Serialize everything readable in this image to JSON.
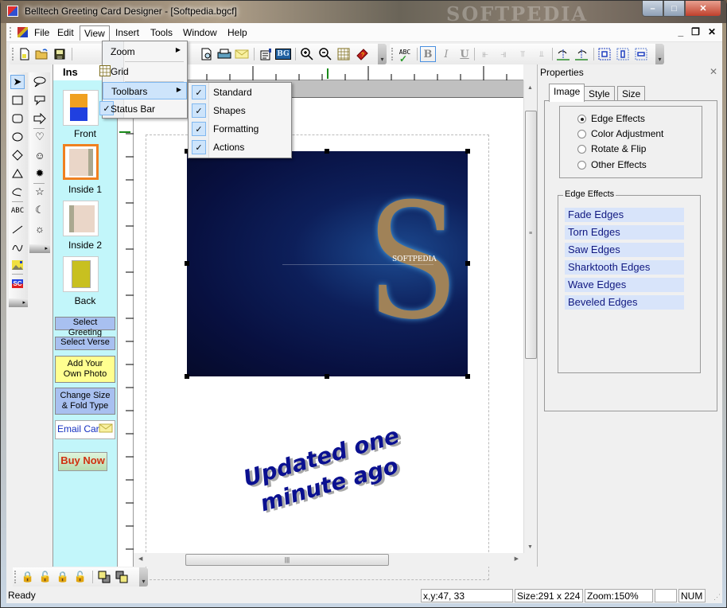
{
  "window": {
    "title": "Belltech Greeting Card Designer  - [Softpedia.bgcf]",
    "watermark": "SOFTPEDIA",
    "caption_minimize": "–",
    "caption_maximize": "□",
    "caption_close": "✕"
  },
  "menubar": {
    "items": [
      "File",
      "Edit",
      "View",
      "Insert",
      "Tools",
      "Window",
      "Help"
    ],
    "active": "View",
    "mdi_minimize": "_",
    "mdi_restore": "❐",
    "mdi_close": "✕"
  },
  "view_menu": {
    "items": [
      {
        "label": "Zoom",
        "has_submenu": true,
        "checked": false
      },
      {
        "label": "Grid",
        "has_submenu": false,
        "checked": false,
        "icon": "grid-icon"
      },
      {
        "label": "Toolbars",
        "has_submenu": true,
        "highlighted": true
      },
      {
        "label": "Status Bar",
        "checked": true
      }
    ]
  },
  "toolbars_submenu": {
    "items": [
      {
        "label": "Standard",
        "checked": true
      },
      {
        "label": "Shapes",
        "checked": true
      },
      {
        "label": "Formatting",
        "checked": true
      },
      {
        "label": "Actions",
        "checked": true
      }
    ]
  },
  "standard_toolbar": {
    "icons": [
      "new-file-icon",
      "open-folder-icon",
      "save-icon",
      "print-preview-icon",
      "print-icon",
      "email-icon",
      "properties-icon",
      "background-icon",
      "zoom-in-icon",
      "zoom-out-icon",
      "grid-icon",
      "help-book-icon"
    ],
    "bg_label": "BG"
  },
  "formatting_toolbar": {
    "spellcheck_label": "ABC",
    "bold": "B",
    "italic": "I",
    "underline": "U",
    "icons": [
      "spellcheck-icon",
      "bold-icon",
      "italic-icon",
      "underline-icon",
      "align-left-icon",
      "align-right-icon",
      "align-top-icon",
      "align-bottom-icon",
      "rotate-right-icon",
      "rotate-left-icon",
      "center-icon",
      "center-horizontal-icon",
      "center-vertical-icon"
    ]
  },
  "shapes_toolbar": {
    "column1": [
      "select-arrow",
      "rectangle",
      "rounded-rectangle",
      "ellipse",
      "diamond",
      "triangle",
      "freeform",
      "text-abc",
      "line",
      "curve",
      "picture",
      "clipart-sc"
    ],
    "column2": [
      "callout-oval",
      "callout-round",
      "arrow-right",
      "heart",
      "smiley",
      "burst",
      "star",
      "moon",
      "sun"
    ],
    "text_label": "ABC",
    "sc_label": "SC"
  },
  "pages_panel": {
    "header": "Ins",
    "pages": [
      {
        "label": "Front",
        "selected": false
      },
      {
        "label": "Inside 1",
        "selected": true
      },
      {
        "label": "Inside 2",
        "selected": false
      },
      {
        "label": "Back",
        "selected": false
      }
    ],
    "actions": {
      "select_greeting": "Select Greeting",
      "select_verse": "Select Verse",
      "add_photo_line1": "Add Your",
      "add_photo_line2": "Own Photo",
      "change_size_line1": "Change Size",
      "change_size_line2": "& Fold Type",
      "email_card": "Email Card",
      "buy_now": "Buy Now"
    }
  },
  "canvas": {
    "photo_brand": "SOFTPEDIA",
    "wordart_line1": "Updated one",
    "wordart_line2": "minute ago"
  },
  "properties": {
    "title": "Properties",
    "close": "✕",
    "tabs": [
      {
        "label": "Image",
        "active": true
      },
      {
        "label": "Style",
        "active": false
      },
      {
        "label": "Size & Pos",
        "active": false
      }
    ],
    "radio_options": [
      {
        "label": "Edge Effects",
        "selected": true
      },
      {
        "label": "Color Adjustment",
        "selected": false
      },
      {
        "label": "Rotate & Flip",
        "selected": false
      },
      {
        "label": "Other Effects",
        "selected": false
      }
    ],
    "edge_effects": {
      "legend": "Edge Effects",
      "items": [
        "Fade Edges",
        "Torn Edges",
        "Saw Edges",
        "Sharktooth Edges",
        "Wave Edges",
        "Beveled Edges"
      ]
    }
  },
  "actions_toolbar": {
    "icons": [
      "lock-icon",
      "unlock-icon",
      "lock-all-icon",
      "unlock-all-icon",
      "bring-front-icon",
      "send-back-icon"
    ]
  },
  "statusbar": {
    "ready": "Ready",
    "coords": "x,y:47, 33",
    "size": "Size:291 x 224",
    "zoom": "Zoom:150%",
    "blank": "",
    "num": "NUM"
  }
}
